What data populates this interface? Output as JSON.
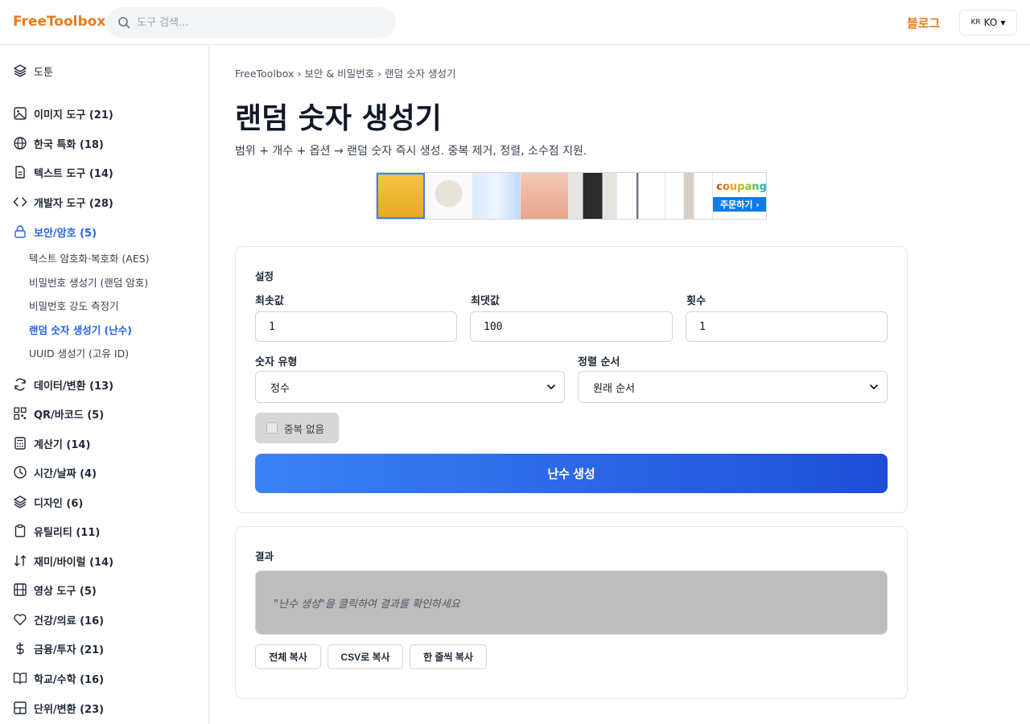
{
  "header": {
    "logo": "FreeToolbox",
    "search_placeholder": "도구 검색...",
    "blog": "블로그",
    "lang_flag": "KR",
    "lang_label": "KO"
  },
  "sidebar": {
    "top_item": "도툰",
    "categories": [
      {
        "label": "이미지 도구 (21)",
        "icon": "image-icon"
      },
      {
        "label": "한국 특화 (18)",
        "icon": "globe-icon"
      },
      {
        "label": "텍스트 도구 (14)",
        "icon": "document-icon"
      },
      {
        "label": "개발자 도구 (28)",
        "icon": "code-icon"
      },
      {
        "label": "보안/암호 (5)",
        "icon": "lock-icon"
      }
    ],
    "sub_items": [
      "텍스트 암호화·복호화 (AES)",
      "비밀번호 생성기 (랜덤 암호)",
      "비밀번호 강도 측정기",
      "랜덤 숫자 생성기 (난수)",
      "UUID 생성기 (고유 ID)"
    ],
    "more_categories": [
      {
        "label": "데이터/변환 (13)",
        "icon": "refresh-icon"
      },
      {
        "label": "QR/바코드 (5)",
        "icon": "qr-icon"
      },
      {
        "label": "계산기 (14)",
        "icon": "calculator-icon"
      },
      {
        "label": "시간/날짜 (4)",
        "icon": "clock-icon"
      },
      {
        "label": "디자인 (6)",
        "icon": "layers-icon"
      },
      {
        "label": "유틸리티 (11)",
        "icon": "clipboard-icon"
      },
      {
        "label": "재미/바이럴 (14)",
        "icon": "dice-icon"
      },
      {
        "label": "영상 도구 (5)",
        "icon": "film-icon"
      },
      {
        "label": "건강/의료 (16)",
        "icon": "heart-icon"
      },
      {
        "label": "금융/투자 (21)",
        "icon": "dollar-icon"
      },
      {
        "label": "학교/수학 (16)",
        "icon": "book-icon"
      },
      {
        "label": "단위/변환 (23)",
        "icon": "grid-icon"
      }
    ]
  },
  "breadcrumb": {
    "home": "FreeToolbox",
    "category": "보안 & 비밀번호",
    "current": "랜덤 숫자 생성기",
    "separator": "›"
  },
  "title": "랜덤 숫자 생성기",
  "subtitle": "범위 + 개수 + 옵션 → 랜덤 숫자 즉시 생성. 중복 제거, 정렬, 소수점 지원.",
  "ad": {
    "brand": "coupang",
    "cta": "주문하기 ›"
  },
  "settings": {
    "title": "설정",
    "min_label": "최솟값",
    "min_value": "1",
    "max_label": "최댓값",
    "max_value": "100",
    "count_label": "횟수",
    "count_value": "1",
    "type_label": "숫자 유형",
    "type_value": "정수",
    "sort_label": "정렬 순서",
    "sort_value": "원래 순서",
    "no_dup_label": "중복 없음",
    "no_dup_checked": false,
    "generate_button": "난수 생성"
  },
  "result": {
    "title": "결과",
    "placeholder": "\"난수 생성\"을 클릭하여 결과를 확인하세요",
    "copy_all": "전체 복사",
    "copy_csv": "CSV로 복사",
    "copy_lines": "한 줄씩 복사"
  },
  "colors": {
    "brand": "#ea7a1e",
    "accent": "#2563eb"
  }
}
